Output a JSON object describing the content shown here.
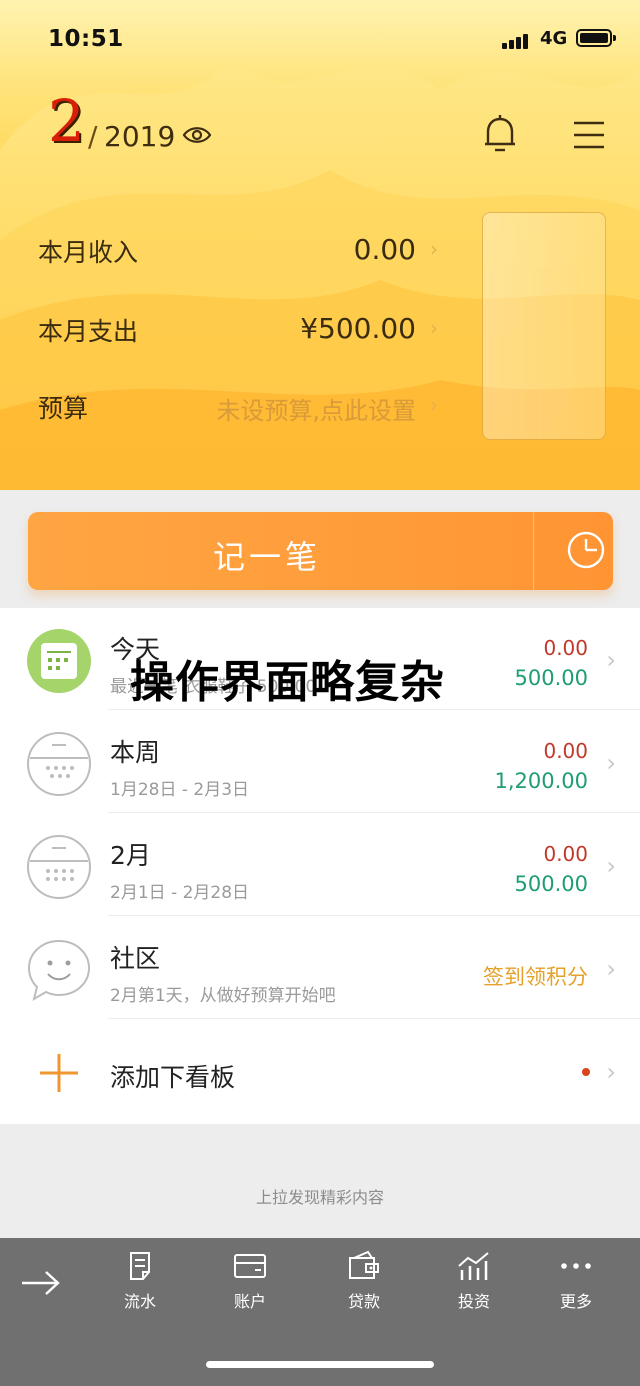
{
  "status_bar": {
    "time": "10:51",
    "network": "4G"
  },
  "header": {
    "month": "2",
    "year_separator": "/",
    "year": "2019",
    "rows": [
      {
        "label": "本月收入",
        "value": "0.00"
      },
      {
        "label": "本月支出",
        "value": "¥500.00"
      },
      {
        "label": "预算",
        "value": "未设预算,点此设置"
      }
    ],
    "colors": {
      "month": "#d81e06",
      "header_top": "#fff3b0",
      "header_bottom": "#ffad20"
    }
  },
  "record_button": {
    "label": "记一笔",
    "accent": "#ff9c3a"
  },
  "overlay_text": "操作界面略复杂",
  "list": [
    {
      "title": "今天",
      "subtitle": "最近一笔 衣服鞋子 500.00",
      "income": "0.00",
      "expense": "500.00",
      "icon": "today-calendar-icon"
    },
    {
      "title": "本周",
      "subtitle": "1月28日 - 2月3日",
      "income": "0.00",
      "expense": "1,200.00",
      "icon": "week-calendar-icon"
    },
    {
      "title": "2月",
      "subtitle": "2月1日 - 2月28日",
      "income": "0.00",
      "expense": "500.00",
      "icon": "month-calendar-icon"
    },
    {
      "title": "社区",
      "subtitle": "2月第1天，从做好预算开始吧",
      "action": "签到领积分",
      "icon": "smile-chat-icon"
    },
    {
      "title": "添加下看板",
      "icon": "plus-icon"
    }
  ],
  "pull_hint": "上拉发现精彩内容",
  "tabs": [
    {
      "label": "流水",
      "icon": "ledger-icon"
    },
    {
      "label": "账户",
      "icon": "wallet-card-icon"
    },
    {
      "label": "贷款",
      "icon": "loan-wallet-icon"
    },
    {
      "label": "投资",
      "icon": "chart-up-icon"
    },
    {
      "label": "更多",
      "icon": "more-dots-icon"
    }
  ]
}
